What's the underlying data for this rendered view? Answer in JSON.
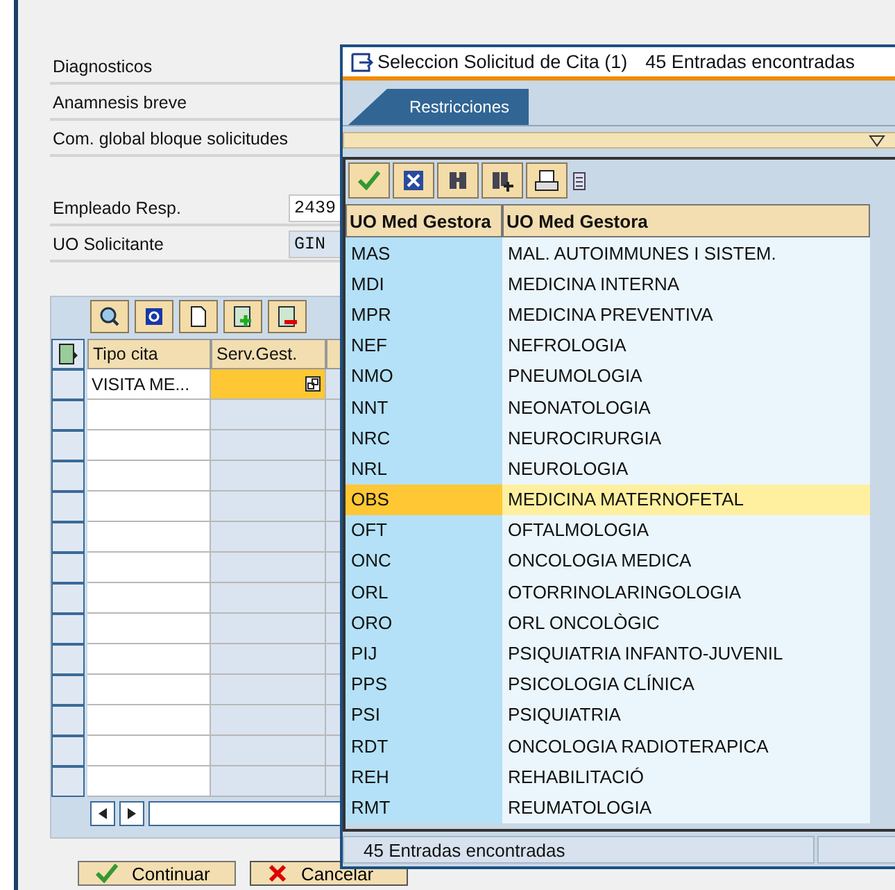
{
  "form": {
    "fields": [
      {
        "label": "Diagnosticos"
      },
      {
        "label": "Anamnesis breve"
      },
      {
        "label": "Com. global bloque solicitudes"
      },
      {
        "label": "Empleado Resp.",
        "value": "2439",
        "readonly": false
      },
      {
        "label": "UO Solicitante",
        "value": "GIN",
        "readonly": true
      }
    ]
  },
  "grid": {
    "columns": [
      "Tipo cita",
      "Serv.Gest."
    ],
    "rows": [
      {
        "tipo_cita": "VISITA ME...",
        "focused": true
      }
    ]
  },
  "buttons": [
    {
      "label": "Continuar",
      "kind": "ok"
    },
    {
      "label": "Cancelar",
      "kind": "cancel"
    }
  ],
  "popup": {
    "title": "Seleccion Solicitud de Cita (1)",
    "title_info": "45 Entradas encontradas",
    "tabs": [
      {
        "label": "Restricciones",
        "selected": true
      }
    ],
    "columns": [
      "UO Med Gestora",
      "UO Med Gestora"
    ],
    "rows": [
      {
        "code": "MAS",
        "name": "MAL. AUTOIMMUNES  I SISTEM.",
        "selected": false
      },
      {
        "code": "MDI",
        "name": "MEDICINA INTERNA",
        "selected": false
      },
      {
        "code": "MPR",
        "name": "MEDICINA PREVENTIVA",
        "selected": false
      },
      {
        "code": "NEF",
        "name": "NEFROLOGIA",
        "selected": false
      },
      {
        "code": "NMO",
        "name": "PNEUMOLOGIA",
        "selected": false
      },
      {
        "code": "NNT",
        "name": "NEONATOLOGIA",
        "selected": false
      },
      {
        "code": "NRC",
        "name": "NEUROCIRURGIA",
        "selected": false
      },
      {
        "code": "NRL",
        "name": "NEUROLOGIA",
        "selected": false
      },
      {
        "code": "OBS",
        "name": "MEDICINA MATERNOFETAL",
        "selected": true
      },
      {
        "code": "OFT",
        "name": "OFTALMOLOGIA",
        "selected": false
      },
      {
        "code": "ONC",
        "name": "ONCOLOGIA MEDICA",
        "selected": false
      },
      {
        "code": "ORL",
        "name": "OTORRINOLARINGOLOGIA",
        "selected": false
      },
      {
        "code": "ORO",
        "name": "ORL ONCOLÒGIC",
        "selected": false
      },
      {
        "code": "PIJ",
        "name": "PSIQUIATRIA INFANTO-JUVENIL",
        "selected": false
      },
      {
        "code": "PPS",
        "name": "PSICOLOGIA CLÍNICA",
        "selected": false
      },
      {
        "code": "PSI",
        "name": "PSIQUIATRIA",
        "selected": false
      },
      {
        "code": "RDT",
        "name": "ONCOLOGIA RADIOTERAPICA",
        "selected": false
      },
      {
        "code": "REH",
        "name": "REHABILITACIÓ",
        "selected": false
      },
      {
        "code": "RMT",
        "name": "REUMATOLOGIA",
        "selected": false
      }
    ],
    "status": "45 Entradas encontradas"
  }
}
